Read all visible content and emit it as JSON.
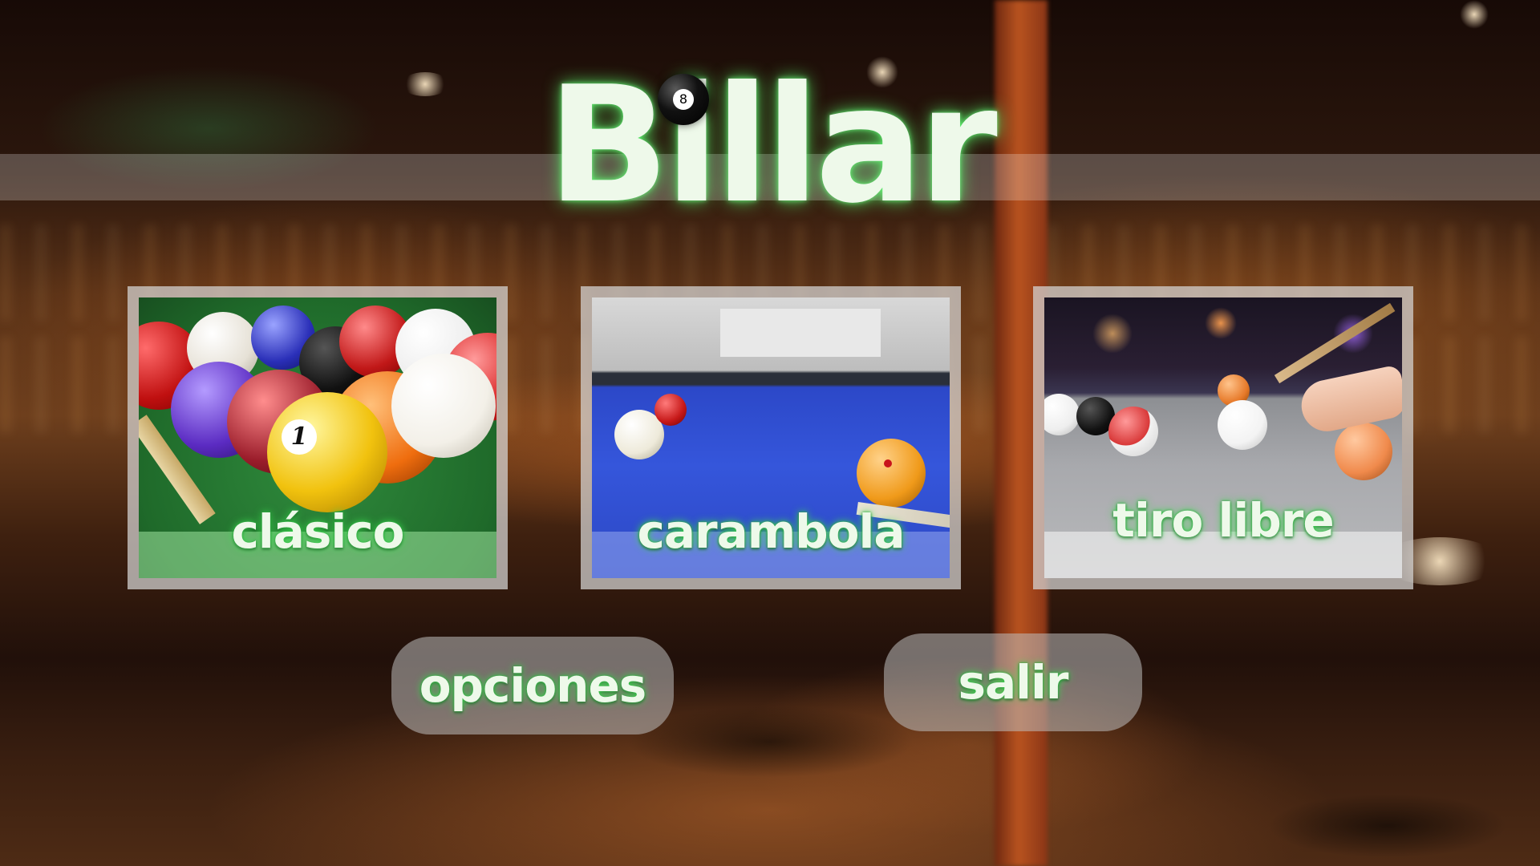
{
  "title": {
    "text": "Billar",
    "eight_ball_number": "8"
  },
  "modes": [
    {
      "label": "clásico"
    },
    {
      "label": "carambola"
    },
    {
      "label": "tiro libre"
    }
  ],
  "buttons": {
    "options": "opciones",
    "exit": "salir"
  },
  "icons": {
    "title_ball": "eight-ball-icon"
  },
  "colors": {
    "text": "#eef9ea",
    "glow": "#5aff6e"
  }
}
